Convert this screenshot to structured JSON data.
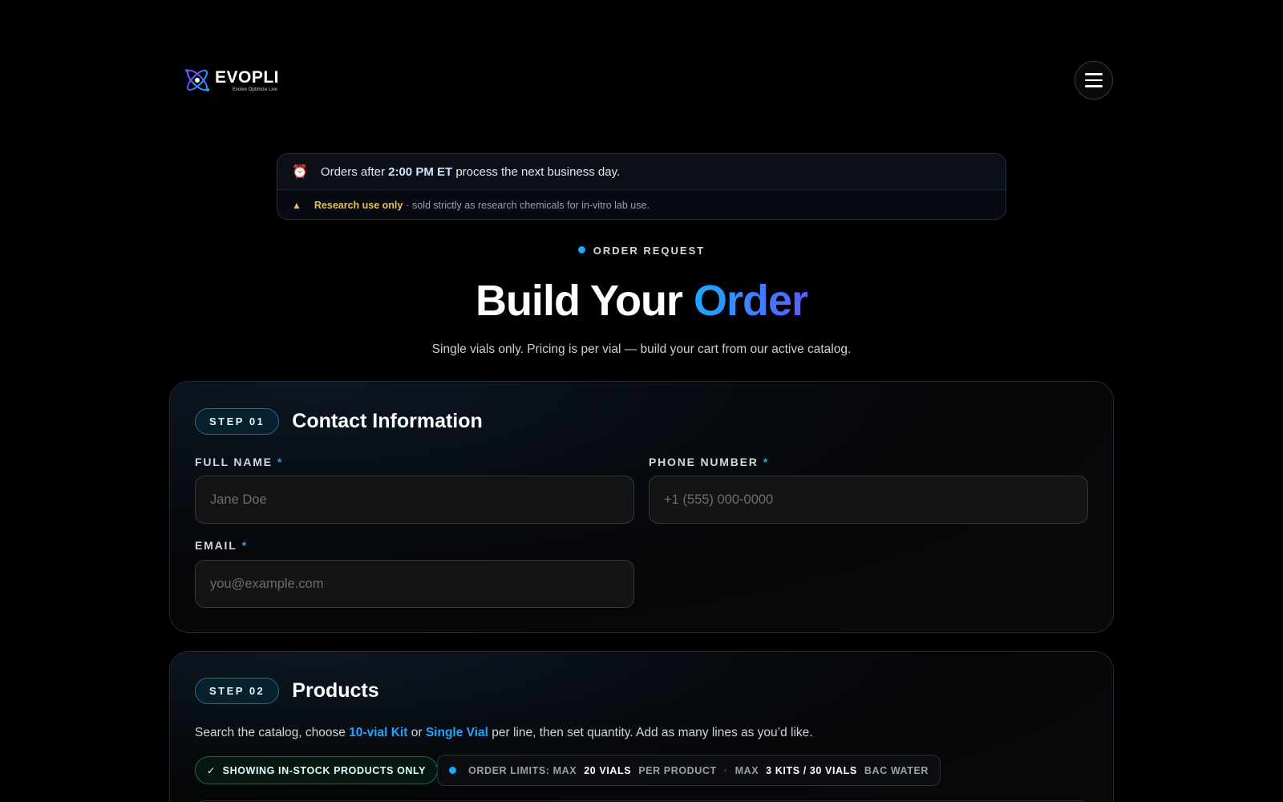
{
  "brand": {
    "name": "EVOPLI",
    "tagline": "Evolve Optimize Live",
    "colors": {
      "accent": "#1ea7ff",
      "accent2": "#5a5cff",
      "warning": "#e8c24a",
      "success": "#1f6b4a"
    }
  },
  "header": {
    "menu_icon": "hamburger-icon"
  },
  "notice": {
    "cutoff_prefix": "Orders after",
    "cutoff_time": "2:00 PM ET",
    "cutoff_suffix": "process the next business day.",
    "research_label": "Research use only",
    "research_text": "· sold strictly as research chemicals for in-vitro lab use."
  },
  "hero": {
    "eyebrow": "ORDER REQUEST",
    "title_main": "Build Your",
    "title_accent": "Order",
    "subtitle": "Single vials only. Pricing is per vial — build your cart from our active catalog."
  },
  "step1": {
    "pill": "STEP 01",
    "title": "Contact Information",
    "fields": {
      "full_name": {
        "label": "FULL NAME",
        "required": "*",
        "placeholder": "Jane Doe",
        "value": ""
      },
      "phone": {
        "label": "PHONE NUMBER",
        "required": "*",
        "placeholder": "+1 (555) 000-0000",
        "value": ""
      },
      "email": {
        "label": "EMAIL",
        "required": "*",
        "placeholder": "you@example.com",
        "value": ""
      }
    }
  },
  "step2": {
    "pill": "STEP 02",
    "title": "Products",
    "desc_prefix": "Search the catalog, choose",
    "desc_kit": "10-vial Kit",
    "desc_or": "or",
    "desc_single": "Single Vial",
    "desc_suffix": "per line, then set quantity. Add as many lines as you’d like.",
    "in_stock_chip": "SHOWING IN-STOCK PRODUCTS ONLY",
    "limits": {
      "prefix": "ORDER LIMITS: MAX",
      "vials": "20 VIALS",
      "per_product": "PER PRODUCT",
      "sep": "·",
      "max": "MAX",
      "kits": "3 KITS / 30 VIALS",
      "bac": "BAC WATER"
    }
  }
}
